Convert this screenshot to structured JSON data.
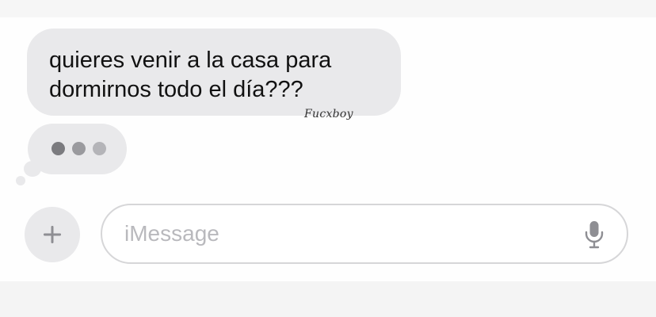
{
  "conversation": {
    "incoming_message": "quieres venir a la casa para\ndormirnos todo el día???",
    "watermark": "Fucxboy",
    "typing_indicator": {
      "dots": 3
    }
  },
  "composer": {
    "add_button_icon": "plus-icon",
    "placeholder": "iMessage",
    "mic_icon": "microphone-icon"
  },
  "colors": {
    "bubble_background": "#e9e9eb",
    "text": "#111111",
    "placeholder_text": "#b9b9bd",
    "icon_gray": "#8e8e93"
  }
}
